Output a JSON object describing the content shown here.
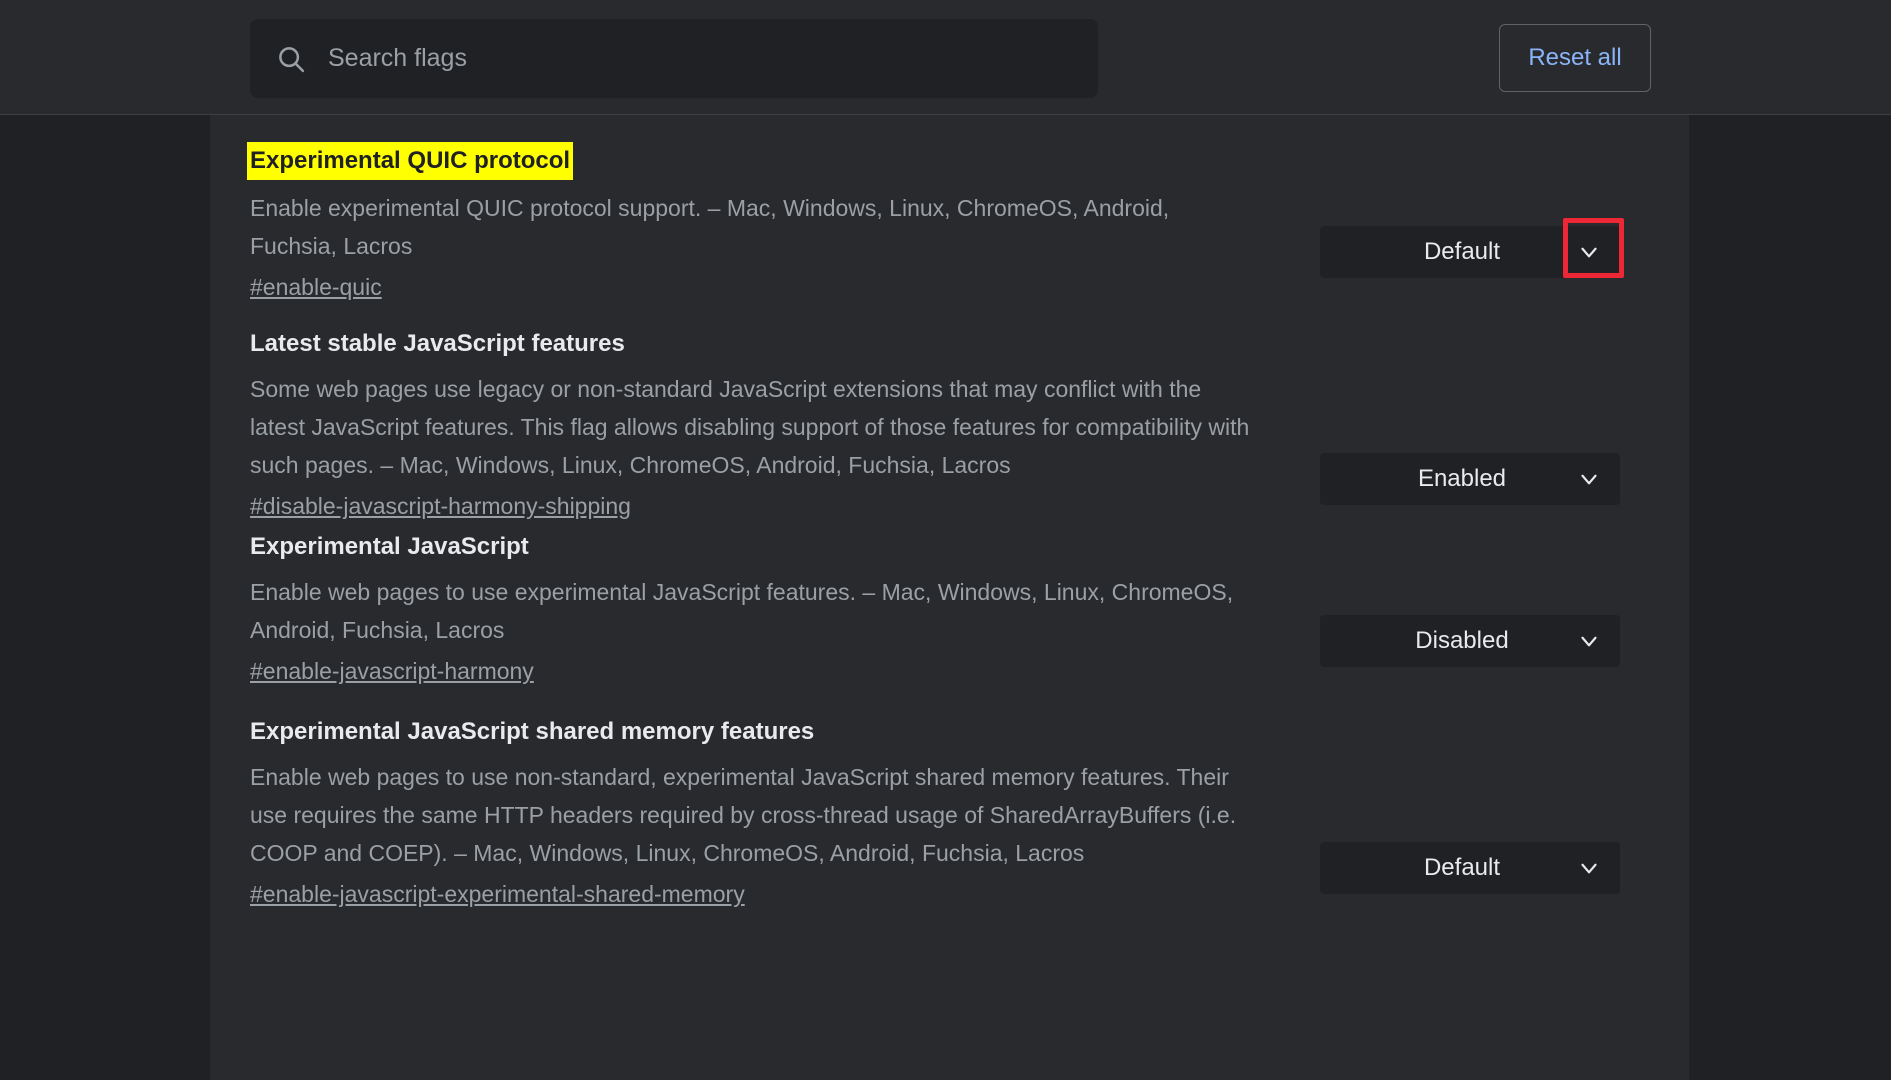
{
  "header": {
    "search": {
      "placeholder": "Search flags",
      "value": "",
      "icon": "search-icon"
    },
    "reset_all_label": "Reset all"
  },
  "colors": {
    "page_background": "#202124",
    "panel_background": "#292a2d",
    "control_background": "#202124",
    "accent_link": "#8ab4f8",
    "title_text": "#e8eaed",
    "body_text": "#9aa0a6",
    "highlight_background": "#ffff00",
    "highlight_text": "#202124",
    "focus_outline": "#ee2737"
  },
  "flags": [
    {
      "title": "Experimental QUIC protocol",
      "highlighted": true,
      "description": "Enable experimental QUIC protocol support. – Mac, Windows, Linux, ChromeOS, Android, Fuchsia, Lacros",
      "link": "#enable-quic",
      "select_value": "Default",
      "select_options": [
        "Default",
        "Enabled",
        "Disabled"
      ],
      "focused": true
    },
    {
      "title": "Latest stable JavaScript features",
      "highlighted": false,
      "description": "Some web pages use legacy or non-standard JavaScript extensions that may conflict with the latest JavaScript features. This flag allows disabling support of those features for compatibility with such pages. – Mac, Windows, Linux, ChromeOS, Android, Fuchsia, Lacros",
      "link": "#disable-javascript-harmony-shipping",
      "select_value": "Enabled",
      "select_options": [
        "Default",
        "Enabled",
        "Disabled"
      ],
      "focused": false
    },
    {
      "title": "Experimental JavaScript",
      "highlighted": false,
      "description": "Enable web pages to use experimental JavaScript features. – Mac, Windows, Linux, ChromeOS, Android, Fuchsia, Lacros",
      "link": "#enable-javascript-harmony",
      "select_value": "Disabled",
      "select_options": [
        "Default",
        "Enabled",
        "Disabled"
      ],
      "focused": false
    },
    {
      "title": "Experimental JavaScript shared memory features",
      "highlighted": false,
      "description": "Enable web pages to use non-standard, experimental JavaScript shared memory features. Their use requires the same HTTP headers required by cross-thread usage of SharedArrayBuffers (i.e. COOP and COEP). – Mac, Windows, Linux, ChromeOS, Android, Fuchsia, Lacros",
      "link": "#enable-javascript-experimental-shared-memory",
      "select_value": "Default",
      "select_options": [
        "Default",
        "Enabled",
        "Disabled"
      ],
      "focused": false
    }
  ]
}
